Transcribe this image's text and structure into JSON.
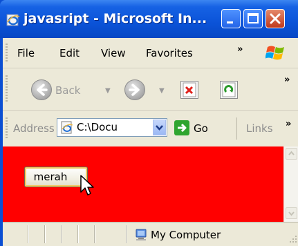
{
  "window": {
    "title": "javasript - Microsoft In...",
    "titlebar_color": "#0b53d8"
  },
  "menu": {
    "items": [
      "File",
      "Edit",
      "View",
      "Favorites"
    ],
    "overflow": "»"
  },
  "toolbar": {
    "back_label": "Back",
    "overflow": "»"
  },
  "address": {
    "label": "Address",
    "value": "C:\\Docu",
    "go_label": "Go",
    "links_label": "Links",
    "links_overflow": "»"
  },
  "page": {
    "background": "#ff0000",
    "button_label": "merah"
  },
  "status": {
    "zone_text": "My Computer"
  },
  "icons": [
    "ie-icon",
    "minimize-icon",
    "maximize-icon",
    "close-icon",
    "windows-logo-icon",
    "back-icon",
    "forward-icon",
    "stop-icon",
    "refresh-icon",
    "page-icon",
    "go-arrow-icon",
    "mouse-cursor-icon",
    "computer-icon"
  ]
}
